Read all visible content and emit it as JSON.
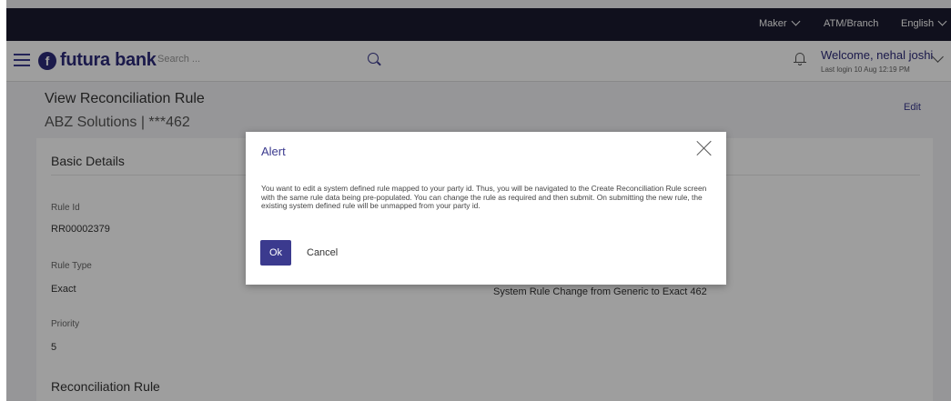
{
  "topbar": {
    "role": "Maker",
    "entity": "ATM/Branch",
    "language": "English"
  },
  "header": {
    "brand": "futura bank",
    "search_placeholder": "Search ...",
    "welcome": "Welcome, nehal joshi",
    "last_login": "Last login 10 Aug 12:19 PM"
  },
  "page": {
    "title": "View Reconciliation Rule",
    "subtitle": "ABZ Solutions | ***462",
    "edit_label": "Edit"
  },
  "basic_details": {
    "title": "Basic Details",
    "fields": [
      {
        "label": "Rule Id",
        "value": "RR00002379"
      },
      {
        "label": "Rule Type",
        "value": "Exact"
      },
      {
        "label": "Priority",
        "value": "5"
      }
    ],
    "description_value": "System Rule Change from Generic to Exact 462"
  },
  "recon_section": {
    "title": "Reconciliation Rule"
  },
  "modal": {
    "title": "Alert",
    "message": "You want to edit a system defined rule mapped to your party id. Thus, you will be navigated to the Create Reconciliation Rule screen with the same rule data being pre-populated. You can change the rule as required and then submit. On submitting the new rule, the existing system defined rule will be unmapped from your party id.",
    "ok_label": "Ok",
    "cancel_label": "Cancel"
  },
  "colors": {
    "brand": "#2d2a7a",
    "primary_button": "#3b3a8e",
    "topbar": "#1b1b2f"
  }
}
